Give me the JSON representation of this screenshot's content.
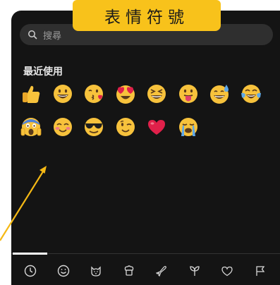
{
  "banner": {
    "title": "表情符號"
  },
  "search": {
    "placeholder": "搜尋"
  },
  "recent": {
    "title": "最近使用",
    "emojis": [
      "thumbs-up-icon",
      "grinning-face-icon",
      "face-blowing-kiss-icon",
      "heart-eyes-icon",
      "grinning-squinting-face-icon",
      "face-with-tongue-icon",
      "grinning-sweat-icon",
      "tears-of-joy-icon",
      "screaming-face-icon",
      "smiling-blushing-face-icon",
      "sunglasses-face-icon",
      "winking-face-icon",
      "red-heart-icon",
      "loudly-crying-face-icon"
    ]
  },
  "tabs": [
    "recent-clock-icon",
    "smiley-icon",
    "animal-icon",
    "food-icon",
    "travel-plane-icon",
    "plant-icon",
    "heart-outline-icon",
    "flag-icon"
  ],
  "colors": {
    "accent": "#f8c21b",
    "panel": "#141414",
    "emoji_yellow": "#f7c23c",
    "arrow": "#f5b915"
  }
}
